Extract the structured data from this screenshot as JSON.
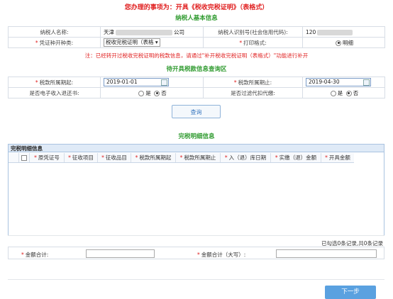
{
  "title": "您办理的事项为：开具《税收完税证明》（表格式）",
  "basic_info": {
    "section_title": "纳税人基本信息",
    "taxpayer_name_label": "纳税人名称:",
    "taxpayer_name_prefix": "天津",
    "taxpayer_name_suffix": "公司",
    "taxpayer_id_label": "纳税人识别号(社会信用代码):",
    "taxpayer_id_prefix": "120",
    "voucher_type_label": "凭证种开种类:",
    "voucher_type_value": "税收完税证明（表格",
    "print_format_label": "打印格式:",
    "print_format_value": "明细"
  },
  "notice": "注：已经转开过税收完税证明的税款信息，请通过\"补开税收完税证明（表格式）\"功能进行补开",
  "query": {
    "section_title": "待开具税款信息查询区",
    "start_label": "税款所属期起:",
    "start_value": "2019-01-01",
    "end_label": "税款所属期止:",
    "end_value": "2019-04-30",
    "e_refund_label": "是否电子收入退还书:",
    "withholding_label": "是否过滤代扣代缴:",
    "yes": "是",
    "no": "否",
    "query_button": "查询"
  },
  "detail": {
    "section_title": "完税明细信息",
    "grid_caption": "完税明细信息",
    "columns": [
      "原凭证号",
      "征收项目",
      "征收品目",
      "税款所属期起",
      "税款所属期止",
      "入（退）库日期",
      "实缴（退）金额",
      "开具金额"
    ],
    "records_text": "已勾选0条记录,共0条记录"
  },
  "summary": {
    "amount_total_label": "金额合计:",
    "amount_total_upper_label": "金额合计（大写）:"
  },
  "next_button": "下一步"
}
